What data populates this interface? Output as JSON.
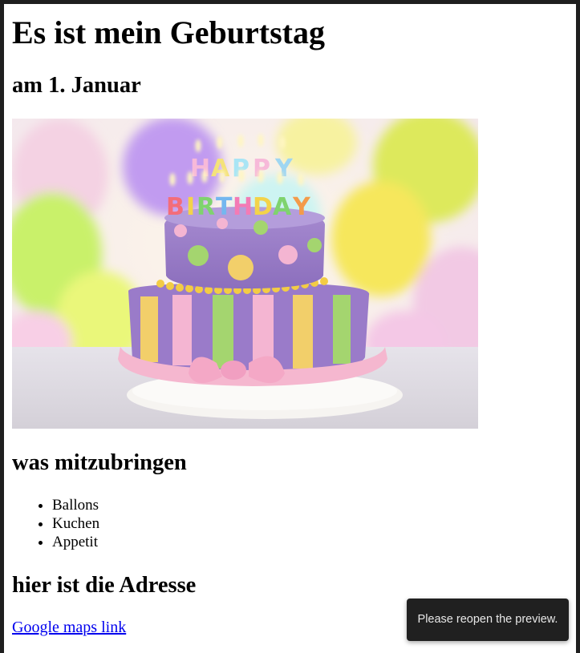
{
  "page": {
    "title": "Es ist mein Geburtstag",
    "date_heading": "am 1. Januar"
  },
  "image": {
    "cake_letters": "HAPPY BIRTHDAY"
  },
  "bring": {
    "heading": "was mitzubringen",
    "items": [
      "Ballons",
      "Kuchen",
      "Appetit"
    ]
  },
  "address": {
    "heading": "hier ist die Adresse",
    "link_text": "Google maps link"
  },
  "toast": {
    "message": "Please reopen the preview."
  },
  "colors": {
    "window_border": "#1f1f1f",
    "page_background": "#ffffff",
    "link": "#0000ee",
    "toast_background": "#202020",
    "toast_text": "#e8e8e8"
  }
}
